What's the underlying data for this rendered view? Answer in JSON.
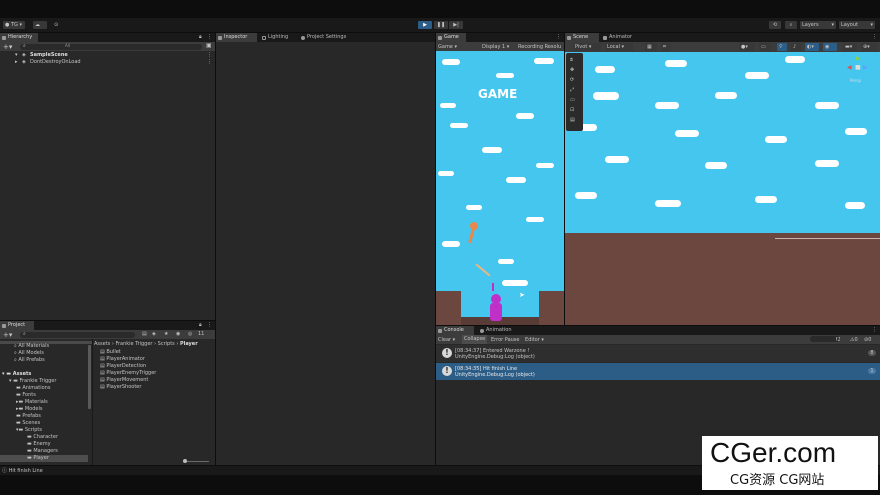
{
  "toolbar": {
    "account": "TG",
    "layers": "Layers",
    "layout": "Layout"
  },
  "hierarchy": {
    "tab": "Hierarchy",
    "search_placeholder": "All",
    "items": [
      {
        "label": "SampleScene"
      },
      {
        "label": "DontDestroyOnLoad"
      }
    ]
  },
  "inspector": {
    "tabs": [
      {
        "label": "Inspector"
      },
      {
        "label": "Lighting"
      },
      {
        "label": "Project Settings"
      }
    ]
  },
  "game": {
    "tab": "Game",
    "display_mode": "Game",
    "display": "Display 1",
    "recording": "Recording Resolu",
    "title_text": "GAME"
  },
  "scene": {
    "tabs": [
      {
        "label": "Scene"
      },
      {
        "label": "Animator"
      }
    ],
    "pivot": "Pivot",
    "local": "Local",
    "persp": "Persp"
  },
  "project": {
    "tab": "Project",
    "favorites": [
      {
        "label": "All Materials"
      },
      {
        "label": "All Models"
      },
      {
        "label": "All Prefabs"
      }
    ],
    "tree": [
      {
        "label": "Assets",
        "depth": 0
      },
      {
        "label": "Frankie Trigger",
        "depth": 1
      },
      {
        "label": "Animations",
        "depth": 2
      },
      {
        "label": "Fonts",
        "depth": 2
      },
      {
        "label": "Materials",
        "depth": 2
      },
      {
        "label": "Models",
        "depth": 2
      },
      {
        "label": "Prefabs",
        "depth": 2
      },
      {
        "label": "Scenes",
        "depth": 2
      },
      {
        "label": "Scripts",
        "depth": 2
      },
      {
        "label": "Character",
        "depth": 3
      },
      {
        "label": "Enemy",
        "depth": 3
      },
      {
        "label": "Managers",
        "depth": 3
      },
      {
        "label": "Player",
        "depth": 3
      }
    ],
    "breadcrumb": [
      "Assets",
      "Frankie Trigger",
      "Scripts",
      "Player"
    ],
    "files": [
      {
        "label": "Bullet"
      },
      {
        "label": "PlayerAnimator"
      },
      {
        "label": "PlayerDetection"
      },
      {
        "label": "PlayerEnemyTrigger"
      },
      {
        "label": "PlayerMovement"
      },
      {
        "label": "PlayerShooter"
      }
    ],
    "hidden_count": "11"
  },
  "console": {
    "tabs": [
      {
        "label": "Console"
      },
      {
        "label": "Animation"
      }
    ],
    "buttons": {
      "clear": "Clear",
      "collapse": "Collapse",
      "error_pause": "Error Pause",
      "editor": "Editor"
    },
    "counts": {
      "info": "2",
      "warn": "0",
      "error": "0"
    },
    "entries": [
      {
        "line1": "[08:34:37] Entered Warzone !",
        "line2": "UnityEngine.Debug:Log (object)",
        "count": "8"
      },
      {
        "line1": "[08:34:35] Hit finish Line",
        "line2": "UnityEngine.Debug:Log (object)",
        "count": "1"
      }
    ]
  },
  "status": {
    "text": "Hit finish Line"
  },
  "watermark": {
    "title": "CGer.com",
    "subtitle": "CG资源 CG网站"
  },
  "colors": {
    "panel": "#282828",
    "header": "#191919",
    "selected": "#2c5d87",
    "sky": "#45c6ef",
    "ground": "#6b4740"
  }
}
